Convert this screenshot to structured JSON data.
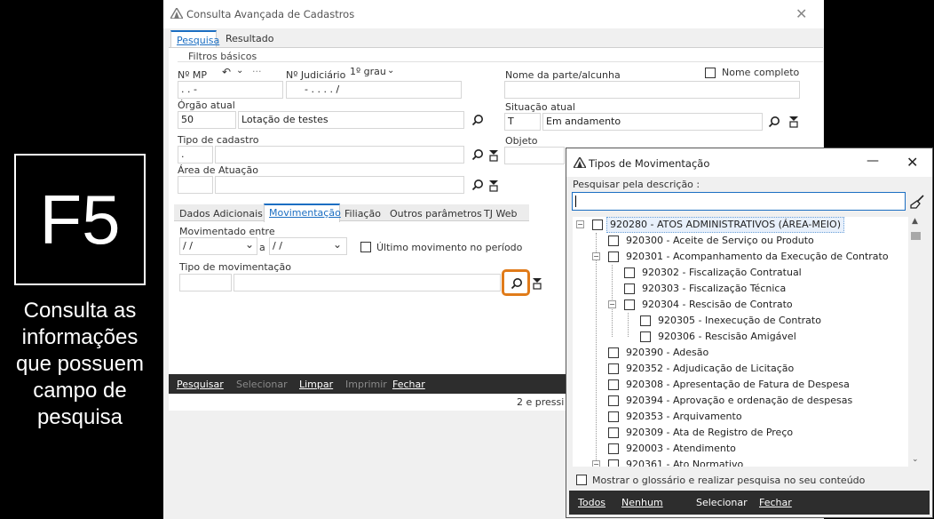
{
  "hint": {
    "key": "F5",
    "description": "Consulta as informações que possuem campo de pesquisa"
  },
  "window": {
    "title": "Consulta Avançada de Cadastros"
  },
  "tabs": [
    "Pesquisa",
    "Resultado"
  ],
  "group_label": "Filtros básicos",
  "form": {
    "nmp_label": "Nº MP",
    "nmp_value": ".   .        -",
    "njud_label": "Nº Judiciário",
    "njud_value": "-   .   .   .   .   /",
    "grau": "1º grau",
    "parte_label": "Nome da parte/alcunha",
    "nome_completo": "Nome completo",
    "orgao_label": "Órgão atual",
    "orgao_code": "50",
    "orgao_name": "Lotação de testes",
    "situacao_label": "Situação atual",
    "situacao_code": "T",
    "situacao_name": "Em andamento",
    "tipo_cad_label": "Tipo de cadastro",
    "tipo_cad_code": ".",
    "objeto_label": "Objeto",
    "area_label": "Área de Atuação"
  },
  "subtabs": [
    "Dados Adicionais",
    "Movimentação",
    "Filiação",
    "Outros parâmetros",
    "TJ Web"
  ],
  "mov": {
    "entre_label": "Movimentado entre",
    "date1": " / /",
    "conj": "a",
    "date2": " / /",
    "ultimo": "Último movimento no período",
    "tipo_label": "Tipo de movimentação"
  },
  "footer": {
    "pesquisar": "Pesquisar",
    "selecionar": "Selecionar",
    "limpar": "Limpar",
    "imprimir": "Imprimir",
    "fechar": "Fechar"
  },
  "status_text": "2 e pressi",
  "dialog": {
    "title": "Tipos de Movimentação",
    "search_label": "Pesquisar pela descrição :",
    "tree": [
      "920280 - ATOS ADMINISTRATIVOS (ÁREA-MEIO)",
      "920300 - Aceite de Serviço ou Produto",
      "920301 - Acompanhamento da Execução de Contrato",
      "920302 - Fiscalização Contratual",
      "920303 - Fiscalização Técnica",
      "920304 - Rescisão de Contrato",
      "920305 - Inexecução de Contrato",
      "920306 - Rescisão Amigável",
      "920390 - Adesão",
      "920352 - Adjudicação de Licitação",
      "920308 - Apresentação de Fatura de Despesa",
      "920394 - Aprovação e ordenação de despesas",
      "920353 - Arquivamento",
      "920309 - Ata de Registro de Preço",
      "920003 - Atendimento",
      "920361 - Ato Normativo"
    ],
    "glossario": "Mostrar o glossário e realizar pesquisa no seu conteúdo",
    "footer": {
      "todos": "Todos",
      "nenhum": "Nenhum",
      "selecionar": "Selecionar",
      "fechar": "Fechar"
    }
  },
  "colors": {
    "accent": "#1b6ec2",
    "highlight": "#e07b1a",
    "footer_bg": "#2d2d2d"
  }
}
